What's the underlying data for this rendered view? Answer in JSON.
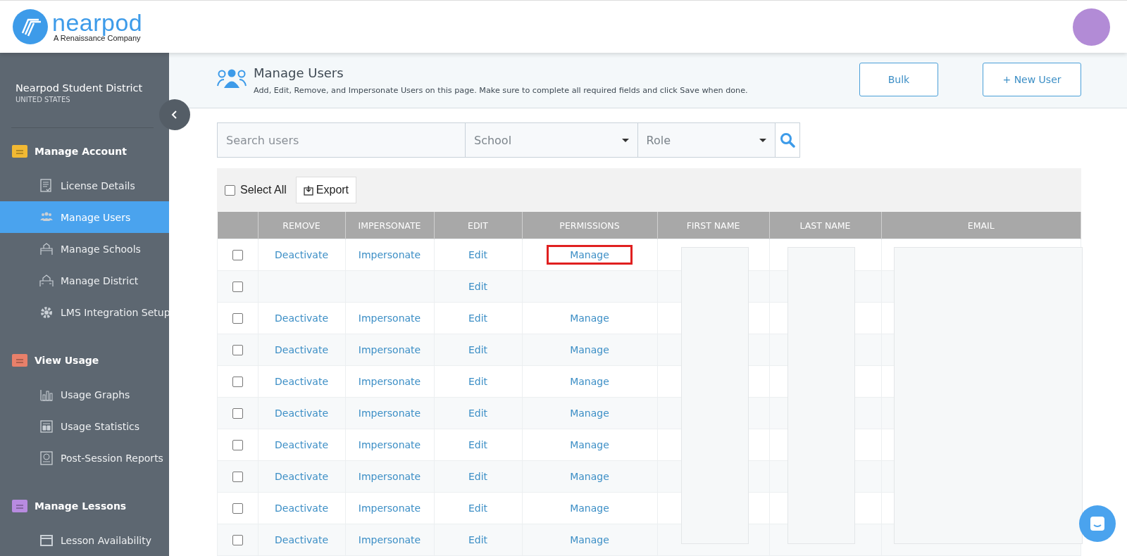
{
  "header": {
    "logo": {
      "wordmark": "nearpod",
      "tagline": "A Renaissance Company"
    }
  },
  "sidebar": {
    "org_name": "Nearpod Student District",
    "country": "UNITED STATES",
    "sections": [
      {
        "title": "Manage Account",
        "color": "#f2b933",
        "items": [
          {
            "label": "License Details",
            "selected": false
          },
          {
            "label": "Manage Users",
            "selected": true
          },
          {
            "label": "Manage Schools",
            "selected": false
          },
          {
            "label": "Manage District",
            "selected": false
          },
          {
            "label": "LMS Integration Setup",
            "selected": false
          }
        ]
      },
      {
        "title": "View Usage",
        "color": "#e8806a",
        "items": [
          {
            "label": "Usage Graphs",
            "selected": false
          },
          {
            "label": "Usage Statistics",
            "selected": false
          },
          {
            "label": "Post-Session Reports",
            "selected": false
          }
        ]
      },
      {
        "title": "Manage Lessons",
        "color": "#b88be0",
        "items": [
          {
            "label": "Lesson Availability",
            "selected": false
          }
        ]
      }
    ]
  },
  "page_header": {
    "title": "Manage Users",
    "subtitle": "Add, Edit, Remove, and Impersonate Users on this page. Make sure to complete all required fields and click Save when done.",
    "buttons": [
      "Bulk",
      "+ New User"
    ]
  },
  "filters": {
    "search": {
      "placeholder": "Search users"
    },
    "dropdowns": [
      "School",
      "Role"
    ]
  },
  "toolbar": {
    "select_all": {
      "label": "Select All",
      "checked": false
    },
    "export_label": "Export"
  },
  "table": {
    "columns": [
      "REMOVE",
      "IMPERSONATE",
      "EDIT",
      "PERMISSIONS",
      "FIRST NAME",
      "LAST NAME",
      "EMAIL"
    ],
    "rows": [
      {
        "checked": false,
        "remove": "Deactivate",
        "impersonate": "Impersonate",
        "edit": "Edit",
        "permissions": "Manage",
        "highlighted": true
      },
      {
        "checked": false,
        "edit": "Edit",
        "highlighted": false
      },
      {
        "checked": false,
        "remove": "Deactivate",
        "impersonate": "Impersonate",
        "edit": "Edit",
        "permissions": "Manage",
        "highlighted": false
      },
      {
        "checked": false,
        "remove": "Deactivate",
        "impersonate": "Impersonate",
        "edit": "Edit",
        "permissions": "Manage",
        "highlighted": false
      },
      {
        "checked": false,
        "remove": "Deactivate",
        "impersonate": "Impersonate",
        "edit": "Edit",
        "permissions": "Manage",
        "highlighted": false
      },
      {
        "checked": false,
        "remove": "Deactivate",
        "impersonate": "Impersonate",
        "edit": "Edit",
        "permissions": "Manage",
        "highlighted": false
      },
      {
        "checked": false,
        "remove": "Deactivate",
        "impersonate": "Impersonate",
        "edit": "Edit",
        "permissions": "Manage",
        "highlighted": false
      },
      {
        "checked": false,
        "remove": "Deactivate",
        "impersonate": "Impersonate",
        "edit": "Edit",
        "permissions": "Manage",
        "highlighted": false
      },
      {
        "checked": false,
        "remove": "Deactivate",
        "impersonate": "Impersonate",
        "edit": "Edit",
        "permissions": "Manage",
        "highlighted": false
      },
      {
        "checked": false,
        "remove": "Deactivate",
        "impersonate": "Impersonate",
        "edit": "Edit",
        "permissions": "Manage",
        "highlighted": false
      }
    ]
  }
}
